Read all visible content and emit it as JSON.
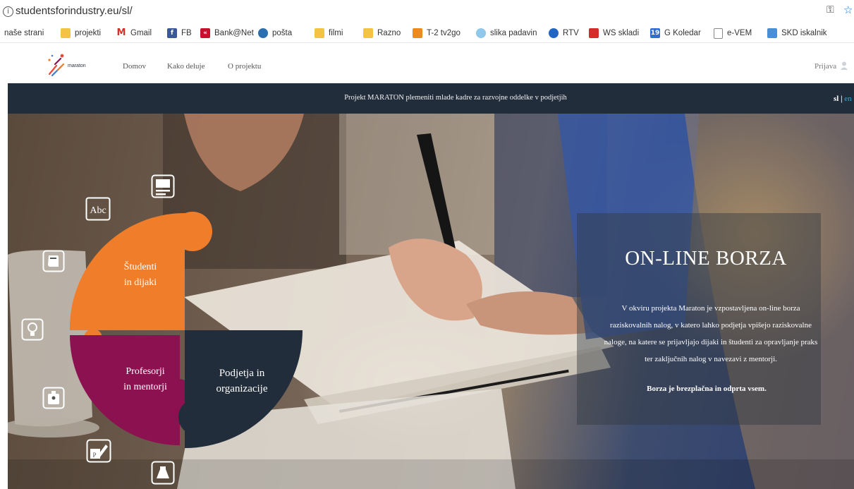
{
  "browser": {
    "url": "studentsforindustry.eu/sl/",
    "bookmarks": [
      {
        "label": "naše strani",
        "icon": "none"
      },
      {
        "label": "projekti",
        "icon": "folder-icon"
      },
      {
        "label": "Gmail",
        "icon": "gmail-icon"
      },
      {
        "label": "FB",
        "icon": "facebook-icon"
      },
      {
        "label": "Bank@Net",
        "icon": "bank-icon"
      },
      {
        "label": "pošta",
        "icon": "posta-icon"
      },
      {
        "label": "filmi",
        "icon": "folder-icon"
      },
      {
        "label": "Razno",
        "icon": "folder-icon"
      },
      {
        "label": "T-2 tv2go",
        "icon": "tv-icon"
      },
      {
        "label": "slika padavin",
        "icon": "weather-icon"
      },
      {
        "label": "RTV",
        "icon": "rtv-icon"
      },
      {
        "label": "WS skladi",
        "icon": "ws-icon"
      },
      {
        "label": "G Koledar",
        "icon": "calendar-icon"
      },
      {
        "label": "e-VEM",
        "icon": "document-icon"
      },
      {
        "label": "SKD iskalnik",
        "icon": "skd-icon"
      }
    ]
  },
  "header": {
    "logo_text": "maraton",
    "nav": [
      "Domov",
      "Kako deluje",
      "O projektu"
    ],
    "login": "Prijava"
  },
  "banner": {
    "text": "Projekt MARATON plemeniti mlade kadre za razvojne oddelke v podjetjih",
    "lang_active": "sl",
    "lang_sep": " | ",
    "lang_other": "en"
  },
  "puzzle": {
    "students": [
      "Študenti",
      "in dijaki"
    ],
    "professors": [
      "Profesorji",
      "in mentorji"
    ],
    "companies": [
      "Podjetja in",
      "organizacije"
    ],
    "colors": {
      "students": "#f07d2a",
      "professors": "#8c1150",
      "companies": "#222d3c"
    }
  },
  "hero_icons": [
    "abc-icon",
    "newspaper-icon",
    "book-icon",
    "lightbulb-icon",
    "badge-icon",
    "certificate-icon",
    "flask-icon"
  ],
  "borza": {
    "title": "ON-LINE BORZA",
    "body": "V okviru projekta Maraton je vzpostavljena on-line borza raziskovalnih nalog, v katero lahko podjetja vpišejo raziskovalne naloge, na katere se prijavljajo dijaki in študenti za opravljanje praks ter zaključnih nalog v navezavi z mentorji.",
    "free": "Borza je brezplačna in odprta vsem."
  }
}
